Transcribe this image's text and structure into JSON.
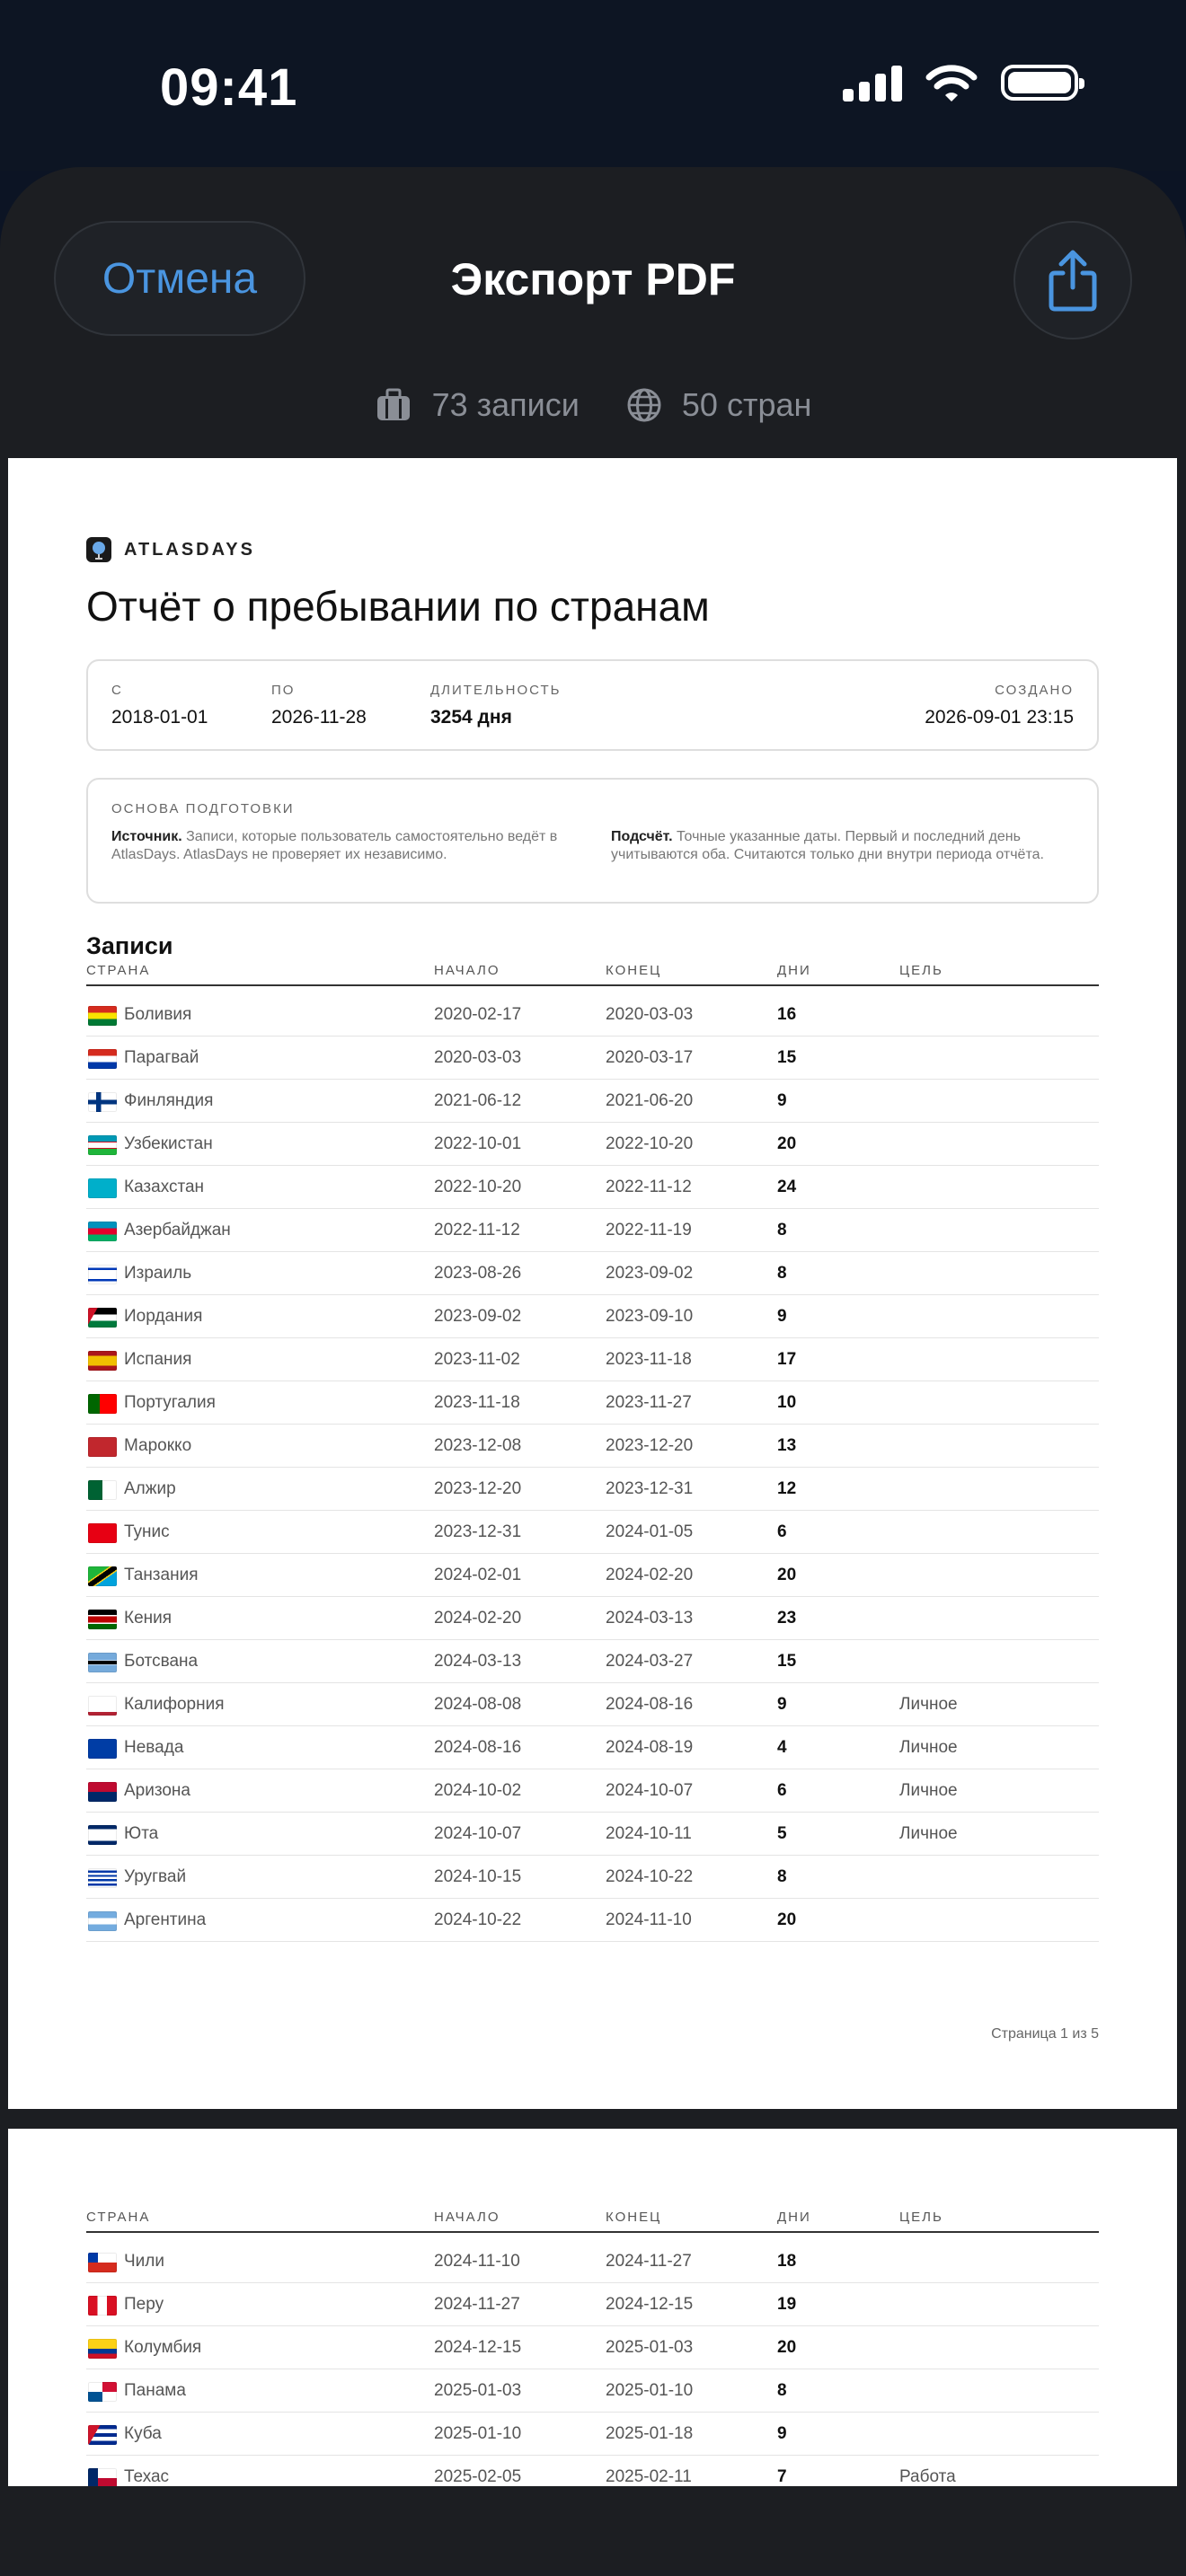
{
  "status_bar": {
    "time": "09:41"
  },
  "header": {
    "cancel_label": "Отмена",
    "title": "Экспорт PDF",
    "records_summary": "73 записи",
    "countries_summary": "50 стран"
  },
  "report": {
    "brand": "ATLASDAYS",
    "title": "Отчёт о пребывании по странам",
    "meta": {
      "from_label": "С",
      "from_value": "2018-01-01",
      "to_label": "ПО",
      "to_value": "2026-11-28",
      "duration_label": "ДЛИТЕЛЬНОСТЬ",
      "duration_value": "3254 дня",
      "created_label": "СОЗДАНО",
      "created_value": "2026-09-01 23:15"
    },
    "basis": {
      "label": "ОСНОВА ПОДГОТОВКИ",
      "source_title": "Источник.",
      "source_text": "Записи, которые пользователь самостоятельно ведёт в AtlasDays. AtlasDays не проверяет их независимо.",
      "count_title": "Подсчёт.",
      "count_text": "Точные указанные даты. Первый и последний день учитываются оба. Считаются только дни внутри периода отчёта."
    },
    "section_title": "Записи",
    "columns": {
      "country": "СТРАНА",
      "start": "НАЧАЛО",
      "end": "КОНЕЦ",
      "days": "ДНИ",
      "purpose": "ЦЕЛЬ"
    },
    "page1_rows": [
      {
        "country": "Боливия",
        "start": "2020-02-17",
        "end": "2020-03-03",
        "days": "16",
        "purpose": ""
      },
      {
        "country": "Парагвай",
        "start": "2020-03-03",
        "end": "2020-03-17",
        "days": "15",
        "purpose": ""
      },
      {
        "country": "Финляндия",
        "start": "2021-06-12",
        "end": "2021-06-20",
        "days": "9",
        "purpose": ""
      },
      {
        "country": "Узбекистан",
        "start": "2022-10-01",
        "end": "2022-10-20",
        "days": "20",
        "purpose": ""
      },
      {
        "country": "Казахстан",
        "start": "2022-10-20",
        "end": "2022-11-12",
        "days": "24",
        "purpose": ""
      },
      {
        "country": "Азербайджан",
        "start": "2022-11-12",
        "end": "2022-11-19",
        "days": "8",
        "purpose": ""
      },
      {
        "country": "Израиль",
        "start": "2023-08-26",
        "end": "2023-09-02",
        "days": "8",
        "purpose": ""
      },
      {
        "country": "Иордания",
        "start": "2023-09-02",
        "end": "2023-09-10",
        "days": "9",
        "purpose": ""
      },
      {
        "country": "Испания",
        "start": "2023-11-02",
        "end": "2023-11-18",
        "days": "17",
        "purpose": ""
      },
      {
        "country": "Португалия",
        "start": "2023-11-18",
        "end": "2023-11-27",
        "days": "10",
        "purpose": ""
      },
      {
        "country": "Марокко",
        "start": "2023-12-08",
        "end": "2023-12-20",
        "days": "13",
        "purpose": ""
      },
      {
        "country": "Алжир",
        "start": "2023-12-20",
        "end": "2023-12-31",
        "days": "12",
        "purpose": ""
      },
      {
        "country": "Тунис",
        "start": "2023-12-31",
        "end": "2024-01-05",
        "days": "6",
        "purpose": ""
      },
      {
        "country": "Танзания",
        "start": "2024-02-01",
        "end": "2024-02-20",
        "days": "20",
        "purpose": ""
      },
      {
        "country": "Кения",
        "start": "2024-02-20",
        "end": "2024-03-13",
        "days": "23",
        "purpose": ""
      },
      {
        "country": "Ботсвана",
        "start": "2024-03-13",
        "end": "2024-03-27",
        "days": "15",
        "purpose": ""
      },
      {
        "country": "Калифорния",
        "start": "2024-08-08",
        "end": "2024-08-16",
        "days": "9",
        "purpose": "Личное"
      },
      {
        "country": "Невада",
        "start": "2024-08-16",
        "end": "2024-08-19",
        "days": "4",
        "purpose": "Личное"
      },
      {
        "country": "Аризона",
        "start": "2024-10-02",
        "end": "2024-10-07",
        "days": "6",
        "purpose": "Личное"
      },
      {
        "country": "Юта",
        "start": "2024-10-07",
        "end": "2024-10-11",
        "days": "5",
        "purpose": "Личное"
      },
      {
        "country": "Уругвай",
        "start": "2024-10-15",
        "end": "2024-10-22",
        "days": "8",
        "purpose": ""
      },
      {
        "country": "Аргентина",
        "start": "2024-10-22",
        "end": "2024-11-10",
        "days": "20",
        "purpose": ""
      }
    ],
    "page1_footer": "Страница 1 из 5",
    "page2_rows": [
      {
        "country": "Чили",
        "start": "2024-11-10",
        "end": "2024-11-27",
        "days": "18",
        "purpose": ""
      },
      {
        "country": "Перу",
        "start": "2024-11-27",
        "end": "2024-12-15",
        "days": "19",
        "purpose": ""
      },
      {
        "country": "Колумбия",
        "start": "2024-12-15",
        "end": "2025-01-03",
        "days": "20",
        "purpose": ""
      },
      {
        "country": "Панама",
        "start": "2025-01-03",
        "end": "2025-01-10",
        "days": "8",
        "purpose": ""
      },
      {
        "country": "Куба",
        "start": "2025-01-10",
        "end": "2025-01-18",
        "days": "9",
        "purpose": ""
      },
      {
        "country": "Техас",
        "start": "2025-02-05",
        "end": "2025-02-11",
        "days": "7",
        "purpose": "Работа"
      }
    ]
  }
}
